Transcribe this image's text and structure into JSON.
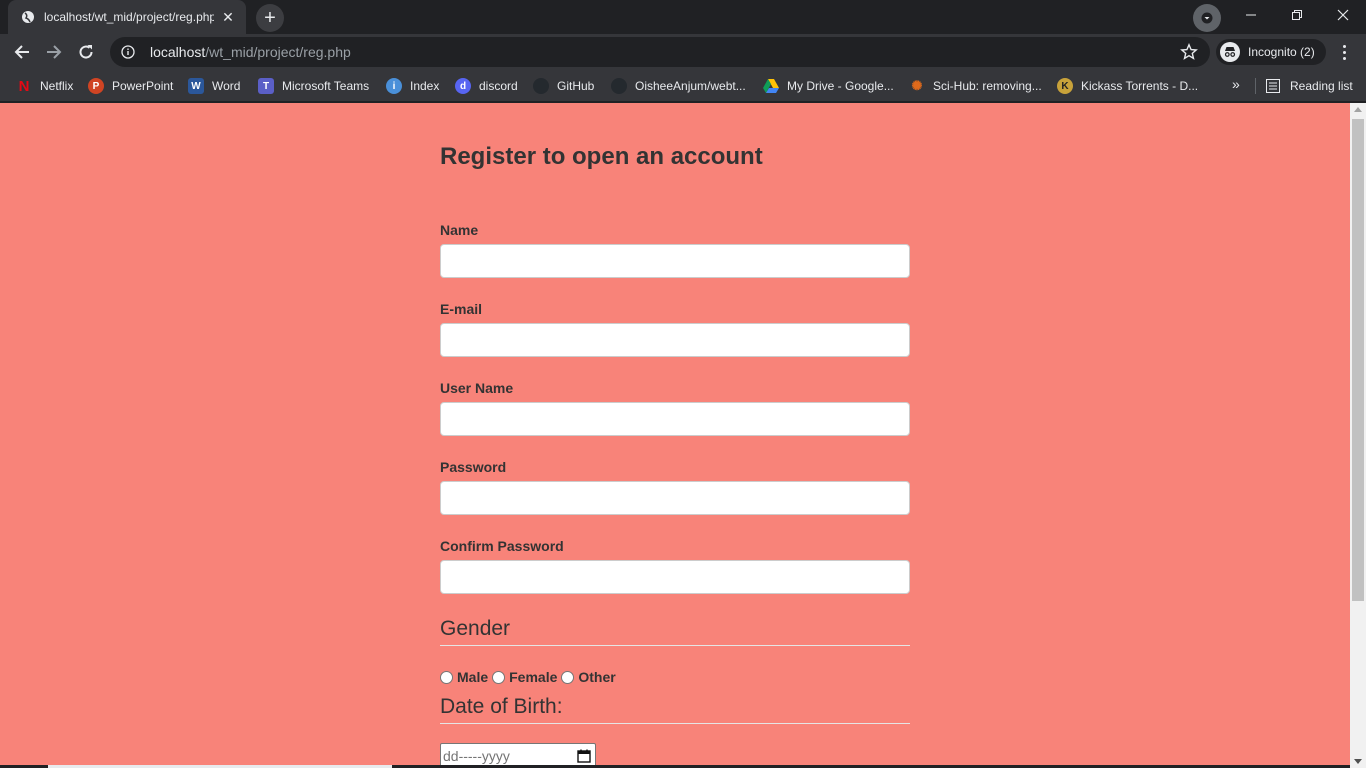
{
  "browser": {
    "tab_title": "localhost/wt_mid/project/reg.php",
    "url_host": "localhost",
    "url_path": "/wt_mid/project/reg.php",
    "incognito_label": "Incognito (2)",
    "bookmarks": [
      {
        "label": "Netflix",
        "icon": "netflix-icon",
        "color": "#e50914"
      },
      {
        "label": "PowerPoint",
        "icon": "powerpoint-icon",
        "color": "#d04423"
      },
      {
        "label": "Word",
        "icon": "word-icon",
        "color": "#2b579a"
      },
      {
        "label": "Microsoft Teams",
        "icon": "teams-icon",
        "color": "#5b5fc7"
      },
      {
        "label": "Index",
        "icon": "index-icon",
        "color": "#4a90d9"
      },
      {
        "label": "discord",
        "icon": "discord-icon",
        "color": "#5865f2"
      },
      {
        "label": "GitHub",
        "icon": "github-icon",
        "color": "#24292e"
      },
      {
        "label": "OisheeAnjum/webt...",
        "icon": "github-icon",
        "color": "#24292e"
      },
      {
        "label": "My Drive - Google...",
        "icon": "google-drive-icon",
        "color": "#0f9d58"
      },
      {
        "label": "Sci-Hub: removing...",
        "icon": "scihub-icon",
        "color": "#e06a1b"
      },
      {
        "label": "Kickass Torrents - D...",
        "icon": "kickass-icon",
        "color": "#c8a23a"
      }
    ],
    "reading_list_label": "Reading list"
  },
  "page": {
    "background_color": "#f88379",
    "form_title": "Register to open an account",
    "fields": {
      "name_label": "Name",
      "email_label": "E-mail",
      "username_label": "User Name",
      "password_label": "Password",
      "confirm_password_label": "Confirm Password"
    },
    "gender": {
      "title": "Gender",
      "options": [
        "Male",
        "Female",
        "Other"
      ]
    },
    "dob": {
      "title": "Date of Birth:",
      "placeholder": "dd-----yyyy"
    }
  }
}
